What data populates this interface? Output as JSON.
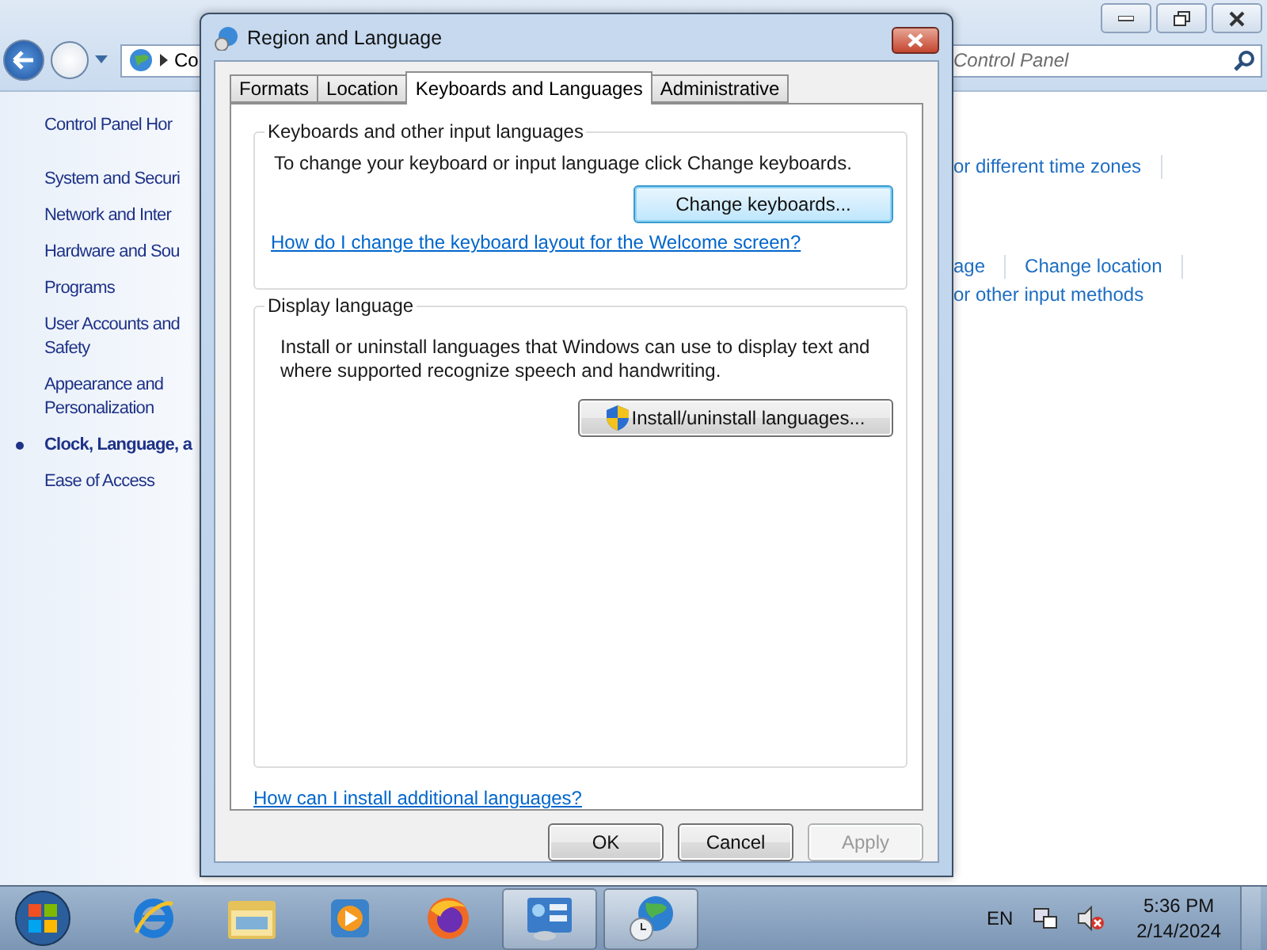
{
  "background_window": {
    "address": "Co",
    "search": "Control Panel",
    "home_link": "Control Panel Hor",
    "nav": [
      {
        "lines": [
          "System and Securi"
        ],
        "selected": false
      },
      {
        "lines": [
          "Network and Inter"
        ],
        "selected": false
      },
      {
        "lines": [
          "Hardware and Sou"
        ],
        "selected": false
      },
      {
        "lines": [
          "Programs"
        ],
        "selected": false
      },
      {
        "lines": [
          "User Accounts and",
          "Safety"
        ],
        "selected": false
      },
      {
        "lines": [
          "Appearance and",
          "Personalization"
        ],
        "selected": false
      },
      {
        "lines": [
          "Clock, Language, a"
        ],
        "selected": true
      },
      {
        "lines": [
          "Ease of Access"
        ],
        "selected": false
      }
    ],
    "link_rows": [
      {
        "links": [
          "or different time zones"
        ]
      },
      {
        "links": [
          "age",
          "Change location"
        ]
      },
      {
        "links": [
          "or other input methods"
        ]
      }
    ]
  },
  "dialog": {
    "title": "Region and Language",
    "tabs": [
      {
        "label": "Formats",
        "selected": false
      },
      {
        "label": "Location",
        "selected": false
      },
      {
        "label": "Keyboards and Languages",
        "selected": true
      },
      {
        "label": "Administrative",
        "selected": false
      }
    ],
    "groups": [
      {
        "title": "Keyboards and other input languages",
        "text": "To change your keyboard or input language click Change keyboards.",
        "button": {
          "label": "Change keyboards...",
          "kind": "plain",
          "focused": true
        },
        "link": "How do I change the keyboard layout for the Welcome screen?"
      },
      {
        "title": "Display language",
        "text": "Install or uninstall languages that Windows can use to display text and where supported recognize speech and handwriting.",
        "button": {
          "label": "Install/uninstall languages...",
          "kind": "shield",
          "focused": false
        }
      }
    ],
    "bottom_link": "How can I install additional languages?",
    "buttons": [
      {
        "label": "OK",
        "disabled": false
      },
      {
        "label": "Cancel",
        "disabled": false
      },
      {
        "label": "Apply",
        "disabled": true
      }
    ]
  },
  "taskbar": {
    "apps": [
      {
        "kind": "ie",
        "active": false
      },
      {
        "kind": "folder",
        "active": false
      },
      {
        "kind": "media",
        "active": false
      },
      {
        "kind": "firefox",
        "active": false
      },
      {
        "kind": "control",
        "active": true
      },
      {
        "kind": "globe",
        "active": true
      }
    ],
    "language": "EN",
    "time": "5:36 PM",
    "date": "2/14/2024"
  }
}
